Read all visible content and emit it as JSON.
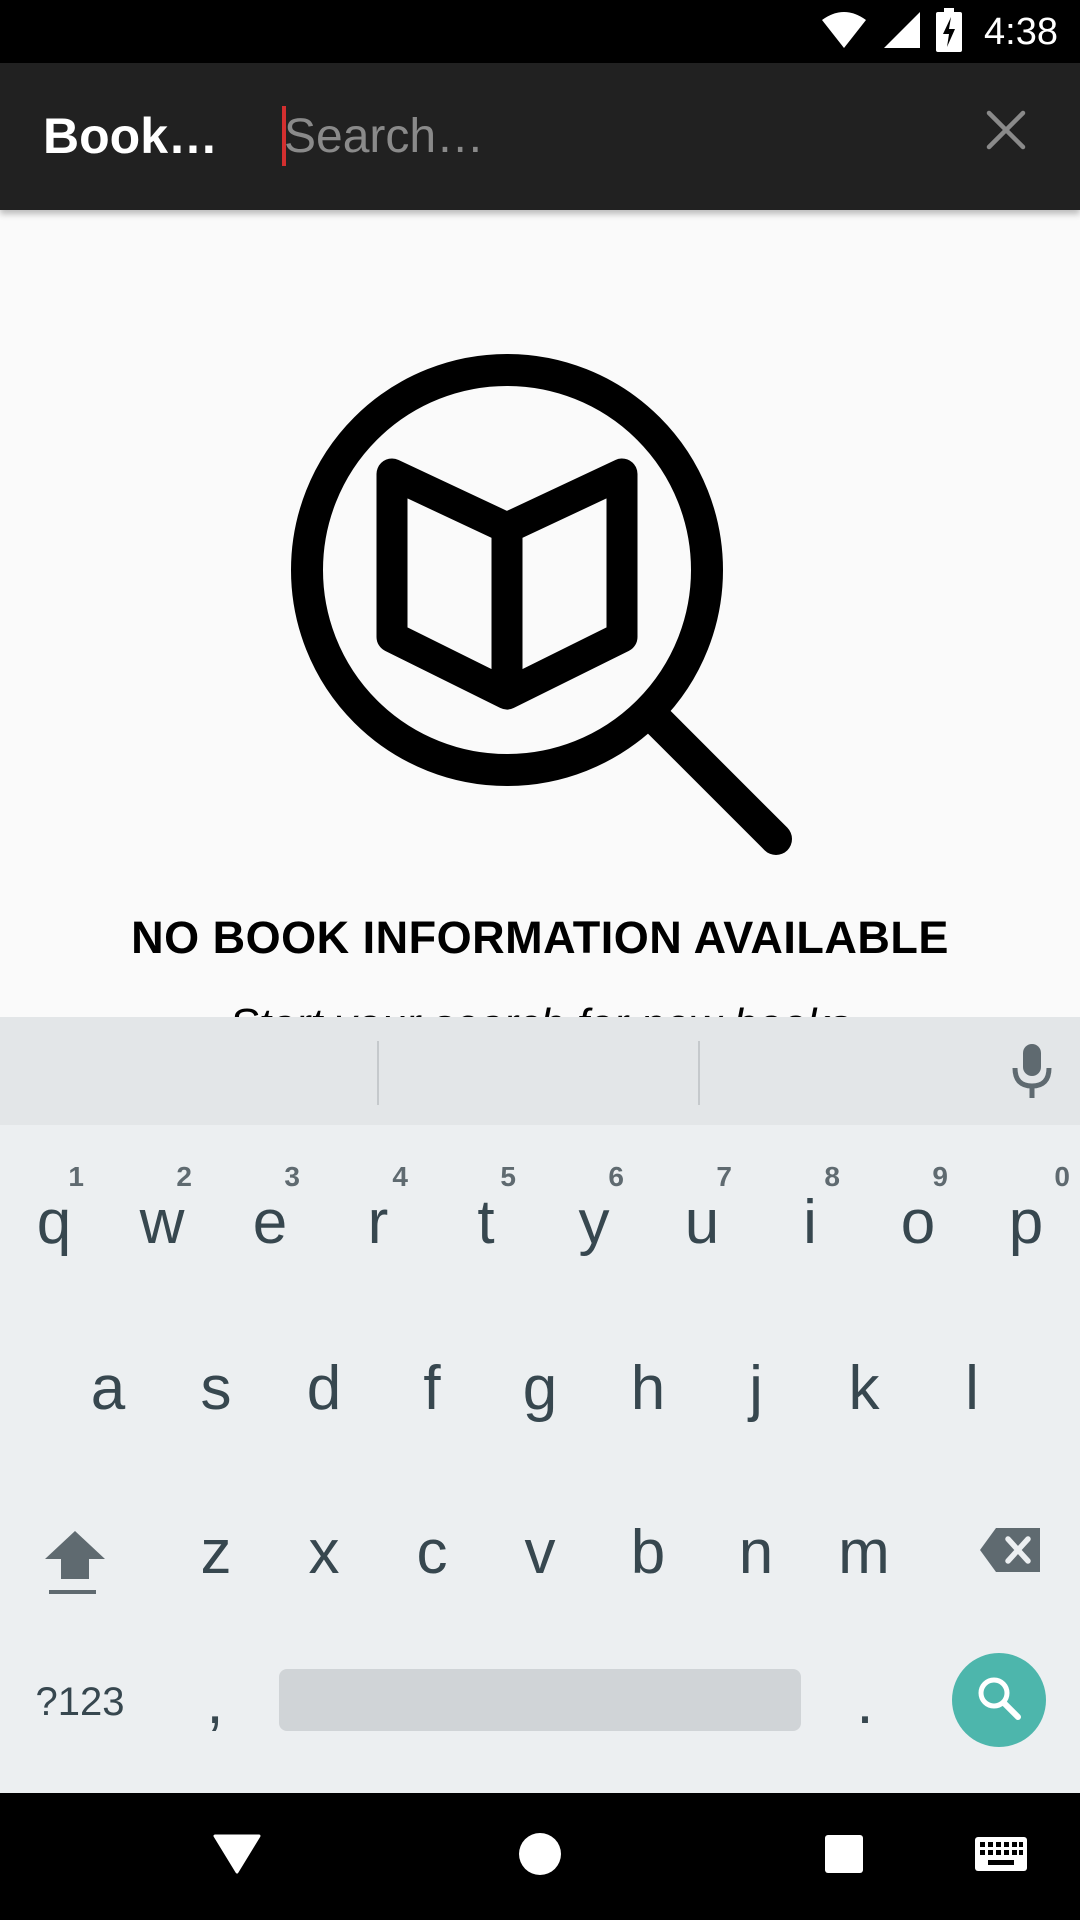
{
  "status_bar": {
    "time": "4:38",
    "icons": [
      "wifi-icon",
      "signal-icon",
      "battery-charging-icon"
    ]
  },
  "app_bar": {
    "title": "Book…",
    "search_placeholder": "Search…",
    "search_value": "",
    "close_icon": "close-icon"
  },
  "empty_state": {
    "icon": "book-search-icon",
    "title": "NO BOOK INFORMATION AVAILABLE",
    "subtitle": "Start your search for new books"
  },
  "keyboard": {
    "row1": [
      {
        "label": "q",
        "hint": "1"
      },
      {
        "label": "w",
        "hint": "2"
      },
      {
        "label": "e",
        "hint": "3"
      },
      {
        "label": "r",
        "hint": "4"
      },
      {
        "label": "t",
        "hint": "5"
      },
      {
        "label": "y",
        "hint": "6"
      },
      {
        "label": "u",
        "hint": "7"
      },
      {
        "label": "i",
        "hint": "8"
      },
      {
        "label": "o",
        "hint": "9"
      },
      {
        "label": "p",
        "hint": "0"
      }
    ],
    "row2": [
      "a",
      "s",
      "d",
      "f",
      "g",
      "h",
      "j",
      "k",
      "l"
    ],
    "row3": [
      "z",
      "x",
      "c",
      "v",
      "b",
      "n",
      "m"
    ],
    "symbols_label": "?123",
    "comma_label": ",",
    "period_label": ".",
    "action_icon": "search-icon",
    "accent_color": "#4db6ac"
  },
  "nav_bar": {
    "icons": [
      "back-icon",
      "home-icon",
      "recents-icon",
      "keyboard-icon"
    ]
  }
}
